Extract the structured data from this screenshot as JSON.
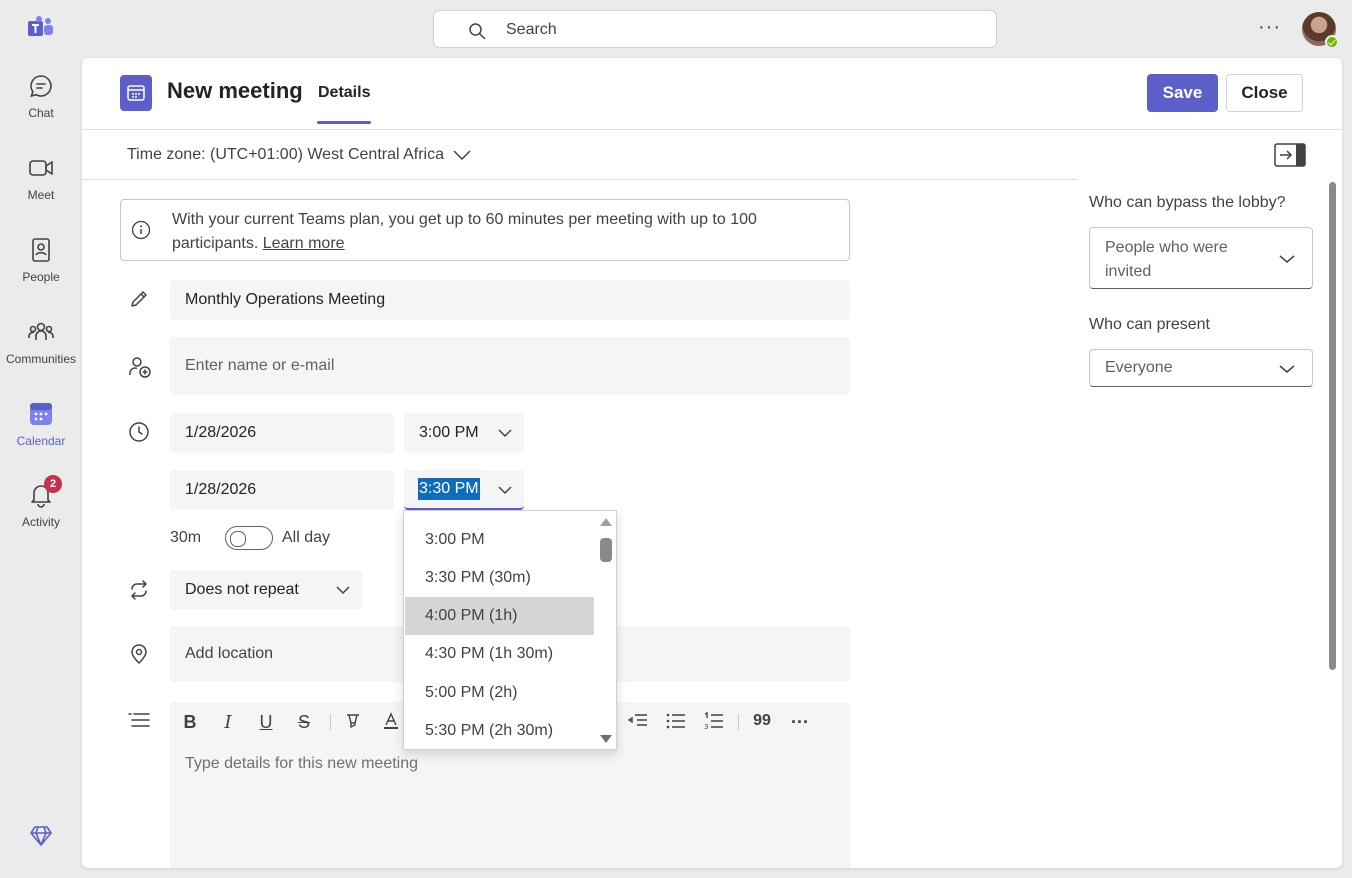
{
  "rail": {
    "items": [
      {
        "label": "Chat",
        "icon": "chat-icon"
      },
      {
        "label": "Meet",
        "icon": "video-icon"
      },
      {
        "label": "People",
        "icon": "contact-card-icon"
      },
      {
        "label": "Communities",
        "icon": "people-community-icon"
      },
      {
        "label": "Calendar",
        "icon": "calendar-icon",
        "active": true
      },
      {
        "label": "Activity",
        "icon": "bell-icon",
        "badge": "2"
      }
    ]
  },
  "topbar": {
    "search_placeholder": "Search",
    "more": "···"
  },
  "header": {
    "title": "New meeting",
    "tab": "Details",
    "save_label": "Save",
    "close_label": "Close"
  },
  "timezone": "Time zone: (UTC+01:00) West Central Africa",
  "info": {
    "text": "With your current Teams plan, you get up to 60 minutes per meeting with up to 100 participants.",
    "link": "Learn more"
  },
  "form": {
    "title_value": "Monthly Operations Meeting",
    "attendees_placeholder": "Enter name or e-mail",
    "start_date": "1/28/2026",
    "start_time": "3:00 PM",
    "end_date": "1/28/2026",
    "end_time": "3:30 PM",
    "duration": "30m",
    "all_day_label": "All day",
    "repeat": "Does not repeat",
    "location_placeholder": "Add location",
    "details_placeholder": "Type details for this new meeting"
  },
  "end_time_options": [
    "3:00 PM",
    "3:30 PM (30m)",
    "4:00 PM (1h)",
    "4:30 PM (1h 30m)",
    "5:00 PM (2h)",
    "5:30 PM (2h 30m)"
  ],
  "highlighted_option": "4:00 PM (1h)",
  "toolbar": {
    "quote": "99",
    "more": "···"
  },
  "right_pane": {
    "lobby_label": "Who can bypass the lobby?",
    "lobby_value": "People who were invited",
    "present_label": "Who can present",
    "present_value": "Everyone"
  },
  "colors": {
    "accent": "#5b5fc7",
    "selection": "#0f6cbd",
    "badge": "#c4314b"
  }
}
